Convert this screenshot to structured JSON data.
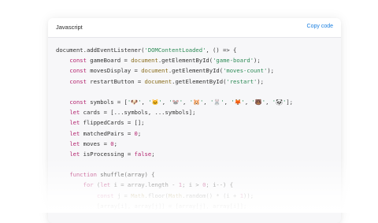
{
  "header": {
    "language": "Javascript",
    "copy_label": "Copy code"
  },
  "code_lines": [
    [
      [
        "document.addEventListener(",
        "p"
      ],
      [
        "'DOMContentLoaded'",
        "s"
      ],
      [
        ", () => {",
        "p"
      ]
    ],
    [
      [
        "    ",
        "p"
      ],
      [
        "const",
        "k"
      ],
      [
        " gameBoard = ",
        "p"
      ],
      [
        "document",
        "f"
      ],
      [
        ".getElementById(",
        "p"
      ],
      [
        "'game-board'",
        "s"
      ],
      [
        ");",
        "p"
      ]
    ],
    [
      [
        "    ",
        "p"
      ],
      [
        "const",
        "k"
      ],
      [
        " movesDisplay = ",
        "p"
      ],
      [
        "document",
        "f"
      ],
      [
        ".getElementById(",
        "p"
      ],
      [
        "'moves-count'",
        "s"
      ],
      [
        ");",
        "p"
      ]
    ],
    [
      [
        "    ",
        "p"
      ],
      [
        "const",
        "k"
      ],
      [
        " restartButton = ",
        "p"
      ],
      [
        "document",
        "f"
      ],
      [
        ".getElementById(",
        "p"
      ],
      [
        "'restart'",
        "s"
      ],
      [
        ");",
        "p"
      ]
    ],
    [
      [
        "",
        "p"
      ]
    ],
    [
      [
        "    ",
        "p"
      ],
      [
        "const",
        "k"
      ],
      [
        " symbols = [",
        "p"
      ],
      [
        "'🐶'",
        "s"
      ],
      [
        ", ",
        "p"
      ],
      [
        "'🐱'",
        "s"
      ],
      [
        ", ",
        "p"
      ],
      [
        "'🐭'",
        "s"
      ],
      [
        ", ",
        "p"
      ],
      [
        "'🐹'",
        "s"
      ],
      [
        ", ",
        "p"
      ],
      [
        "'🐰'",
        "s"
      ],
      [
        ", ",
        "p"
      ],
      [
        "'🦊'",
        "s"
      ],
      [
        ", ",
        "p"
      ],
      [
        "'🐻'",
        "s"
      ],
      [
        ", ",
        "p"
      ],
      [
        "'🐼'",
        "s"
      ],
      [
        "];",
        "p"
      ]
    ],
    [
      [
        "    ",
        "p"
      ],
      [
        "let",
        "k"
      ],
      [
        " cards = [...symbols, ...symbols];",
        "p"
      ]
    ],
    [
      [
        "    ",
        "p"
      ],
      [
        "let",
        "k"
      ],
      [
        " flippedCards = [];",
        "p"
      ]
    ],
    [
      [
        "    ",
        "p"
      ],
      [
        "let",
        "k"
      ],
      [
        " matchedPairs = ",
        "p"
      ],
      [
        "0",
        "n"
      ],
      [
        ";",
        "p"
      ]
    ],
    [
      [
        "    ",
        "p"
      ],
      [
        "let",
        "k"
      ],
      [
        " moves = ",
        "p"
      ],
      [
        "0",
        "n"
      ],
      [
        ";",
        "p"
      ]
    ],
    [
      [
        "    ",
        "p"
      ],
      [
        "let",
        "k"
      ],
      [
        " isProcessing = ",
        "p"
      ],
      [
        "false",
        "k"
      ],
      [
        ";",
        "p"
      ]
    ],
    [
      [
        "",
        "p"
      ]
    ],
    [
      [
        "    ",
        "p"
      ],
      [
        "function",
        "k"
      ],
      [
        " shuffle(array) {",
        "p"
      ]
    ],
    [
      [
        "        ",
        "p"
      ],
      [
        "for",
        "k"
      ],
      [
        " (",
        "p"
      ],
      [
        "let",
        "k"
      ],
      [
        " i = array.length - ",
        "p"
      ],
      [
        "1",
        "n"
      ],
      [
        "; i > ",
        "p"
      ],
      [
        "0",
        "n"
      ],
      [
        "; i--) {",
        "p"
      ]
    ],
    [
      [
        "            ",
        "p"
      ],
      [
        "const",
        "k"
      ],
      [
        " j = ",
        "p"
      ],
      [
        "Math",
        "f"
      ],
      [
        ".floor(",
        "p"
      ],
      [
        "Math",
        "f"
      ],
      [
        ".random() * (i + ",
        "p"
      ],
      [
        "1",
        "n"
      ],
      [
        "));",
        "p"
      ]
    ],
    [
      [
        "            [array[i], array[j]] = [array[j], array[i]];",
        "p"
      ]
    ]
  ]
}
